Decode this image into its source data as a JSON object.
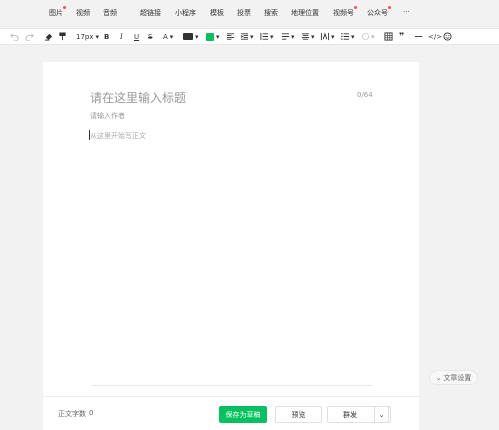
{
  "insert_menu": {
    "items": [
      {
        "label": "图片",
        "dot": true
      },
      {
        "label": "视频",
        "dot": false
      },
      {
        "label": "音频",
        "dot": false
      },
      {
        "label": "超链接",
        "dot": false
      },
      {
        "label": "小程序",
        "dot": false
      },
      {
        "label": "模板",
        "dot": false
      },
      {
        "label": "投票",
        "dot": false
      },
      {
        "label": "搜索",
        "dot": false
      },
      {
        "label": "地理位置",
        "dot": false
      },
      {
        "label": "视频号",
        "dot": true
      },
      {
        "label": "公众号",
        "dot": true
      },
      {
        "label": "···",
        "dot": false
      }
    ]
  },
  "toolbar": {
    "font_size": "17px",
    "bold": "B",
    "italic": "I",
    "underline": "U",
    "strike": "S",
    "font_color": "A"
  },
  "editor": {
    "title_placeholder": "请在这里输入标题",
    "title_count": "0/64",
    "author_placeholder": "请输入作者",
    "body_placeholder": "从这里开始写正文"
  },
  "side": {
    "article_settings": "文章设置"
  },
  "footer": {
    "word_count_label": "正文字数",
    "word_count_value": "0",
    "save_draft": "保存为草稿",
    "preview": "预览",
    "publish": "群发"
  },
  "colors": {
    "accent": "#07c160",
    "dot": "#fa5151"
  }
}
